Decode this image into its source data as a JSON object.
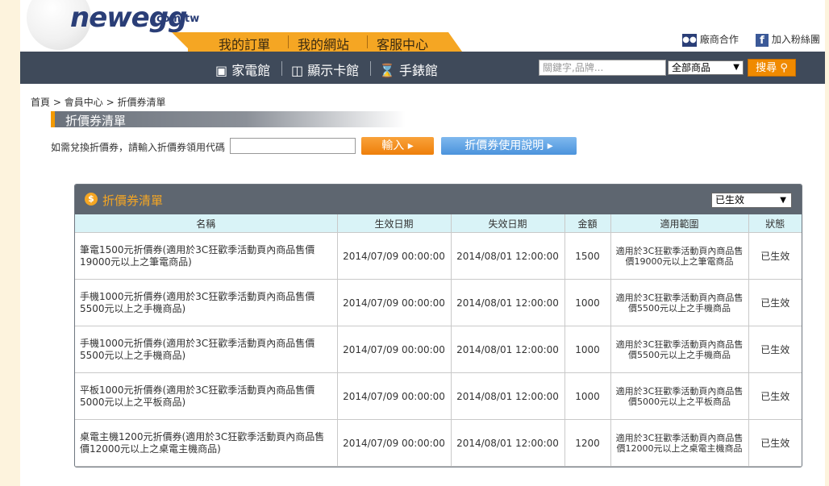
{
  "header": {
    "logo_text": "newegg",
    "logo_suffix": ".com.tw",
    "top_tabs": [
      "我的訂單",
      "我的網站",
      "客服中心"
    ],
    "partner_link": "廠商合作",
    "fan_link": "加入粉絲團",
    "categories": [
      "家電館",
      "顯示卡館",
      "手錶館"
    ],
    "search_placeholder": "關鍵字,品牌...",
    "search_scope": "全部商品",
    "search_button": "搜尋"
  },
  "breadcrumb": [
    "首頁",
    "會員中心",
    "折價券清單"
  ],
  "page_title": "折價券清單",
  "redeem": {
    "label": "如需兌換折價券，請輸入折價券領用代碼",
    "submit_button": "輸入",
    "help_button": "折價券使用說明"
  },
  "panel": {
    "title": "折價券清單",
    "status_filter": "已生效",
    "columns": [
      "名稱",
      "生效日期",
      "失效日期",
      "金額",
      "適用範圍",
      "狀態"
    ],
    "rows": [
      {
        "name": "筆電1500元折價券(適用於3C狂歡季活動頁內商品售價19000元以上之筆電商品)",
        "start": "2014/07/09 00:00:00",
        "end": "2014/08/01 12:00:00",
        "amount": "1500",
        "scope": "適用於3C狂歡季活動頁內商品售價19000元以上之筆電商品",
        "status": "已生效"
      },
      {
        "name": "手機1000元折價券(適用於3C狂歡季活動頁內商品售價5500元以上之手機商品)",
        "start": "2014/07/09 00:00:00",
        "end": "2014/08/01 12:00:00",
        "amount": "1000",
        "scope": "適用於3C狂歡季活動頁內商品售價5500元以上之手機商品",
        "status": "已生效"
      },
      {
        "name": "手機1000元折價券(適用於3C狂歡季活動頁內商品售價5500元以上之手機商品)",
        "start": "2014/07/09 00:00:00",
        "end": "2014/08/01 12:00:00",
        "amount": "1000",
        "scope": "適用於3C狂歡季活動頁內商品售價5500元以上之手機商品",
        "status": "已生效"
      },
      {
        "name": "平板1000元折價券(適用於3C狂歡季活動頁內商品售價5000元以上之平板商品)",
        "start": "2014/07/09 00:00:00",
        "end": "2014/08/01 12:00:00",
        "amount": "1000",
        "scope": "適用於3C狂歡季活動頁內商品售價5000元以上之平板商品",
        "status": "已生效"
      },
      {
        "name": "桌電主機1200元折價券(適用於3C狂歡季活動頁內商品售價12000元以上之桌電主機商品)",
        "start": "2014/07/09 00:00:00",
        "end": "2014/08/01 12:00:00",
        "amount": "1200",
        "scope": "適用於3C狂歡季活動頁內商品售價12000元以上之桌電主機商品",
        "status": "已生效"
      }
    ]
  },
  "colors": {
    "accent_orange": "#f5a623",
    "nav_dark": "#3f4a5a",
    "status_red": "#d0021b",
    "header_row": "#d9f3f7"
  }
}
